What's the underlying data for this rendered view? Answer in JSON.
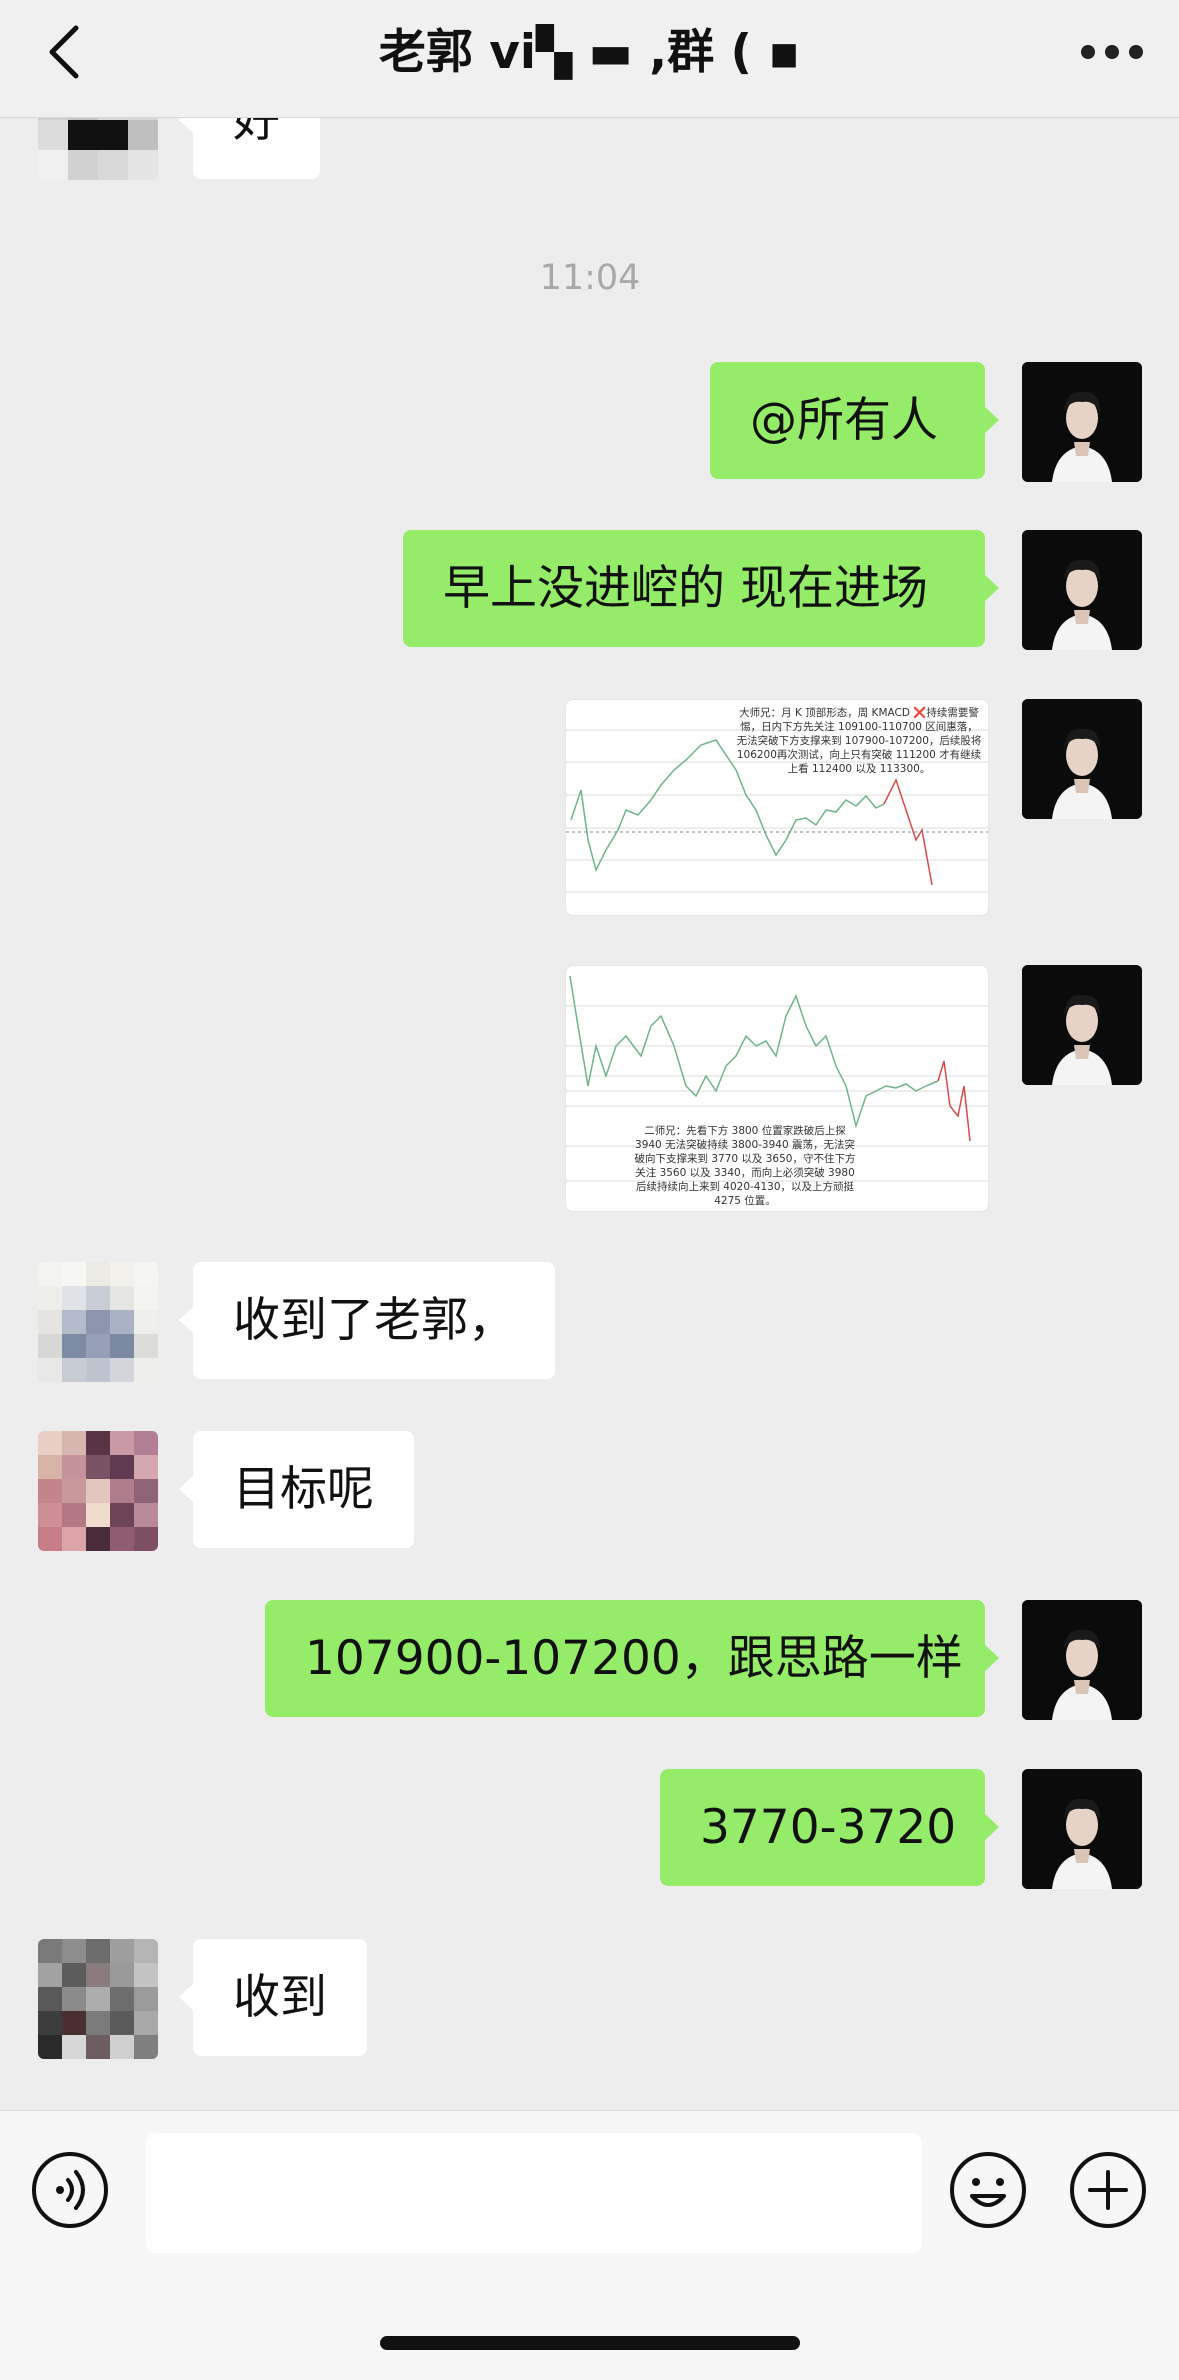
{
  "header": {
    "title": "老郭 vi▚ ▬ ,群 ( ▪",
    "back_icon": "chevron-left-icon",
    "more_icon": "more-dots-icon"
  },
  "messages": [
    {
      "side": "left",
      "text": "好"
    },
    {
      "type": "time",
      "text": "11:04"
    },
    {
      "side": "right",
      "text": "@所有人"
    },
    {
      "side": "right",
      "text": "早上没进崆的 现在进场"
    },
    {
      "side": "right",
      "type": "image",
      "note": "大师兄：月 K 顶部形态，周 KMACD ❌持续需要警惕，日内下方先关注 109100-110700 区间惠落，无法突破下方支撑来到 107900-107200，后续股将 106200再次测试，向上只有突破 111200 才有继续上看 112400 以及 113300。"
    },
    {
      "side": "right",
      "type": "image",
      "note": "二师兄：先看下方 3800 位置家跌破后上探 3940 无法突破持续 3800-3940 震荡，无法突破向下支撑来到 3770 以及 3650，守不住下方关注 3560 以及 3340，而向上必须突破 3980 后续持续向上来到 4020-4130，以及上方顽挺 4275 位置。"
    },
    {
      "side": "left",
      "text": "收到了老郭，"
    },
    {
      "side": "left",
      "text": "目标呢"
    },
    {
      "side": "right",
      "text": "107900-107200，跟思路一样"
    },
    {
      "side": "right",
      "text": "3770-3720"
    },
    {
      "side": "left",
      "text": "收到"
    }
  ],
  "input_bar": {
    "voice_icon": "voice-icon",
    "emoji_icon": "emoji-icon",
    "plus_icon": "plus-icon"
  }
}
